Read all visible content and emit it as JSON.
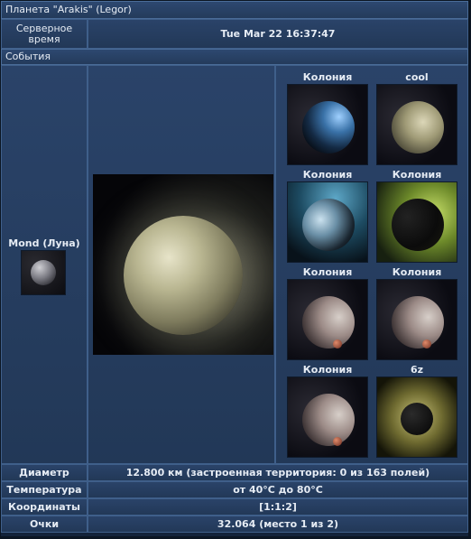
{
  "title": "Планета \"Arakis\" (Legor)",
  "server_time_label": "Серверное время",
  "server_time_value": "Tue Mar 22 16:37:47",
  "events_label": "События",
  "moon_label": "Mond (Луна)",
  "gallery": [
    {
      "label": "Колония"
    },
    {
      "label": "cool"
    },
    {
      "label": "Колония"
    },
    {
      "label": "Колония"
    },
    {
      "label": "Колония"
    },
    {
      "label": "Колония"
    },
    {
      "label": "Колония"
    },
    {
      "label": "6z"
    }
  ],
  "stats": {
    "diameter_label": "Диаметр",
    "diameter_value": "12.800 км (застроенная территория: 0 из 163 полей)",
    "temperature_label": "Температура",
    "temperature_value": "от 40°C до 80°C",
    "coords_label": "Координаты",
    "coords_value": "[1:1:2]",
    "points_label": "Очки",
    "points_value": "32.064 (место 1 из 2)"
  }
}
